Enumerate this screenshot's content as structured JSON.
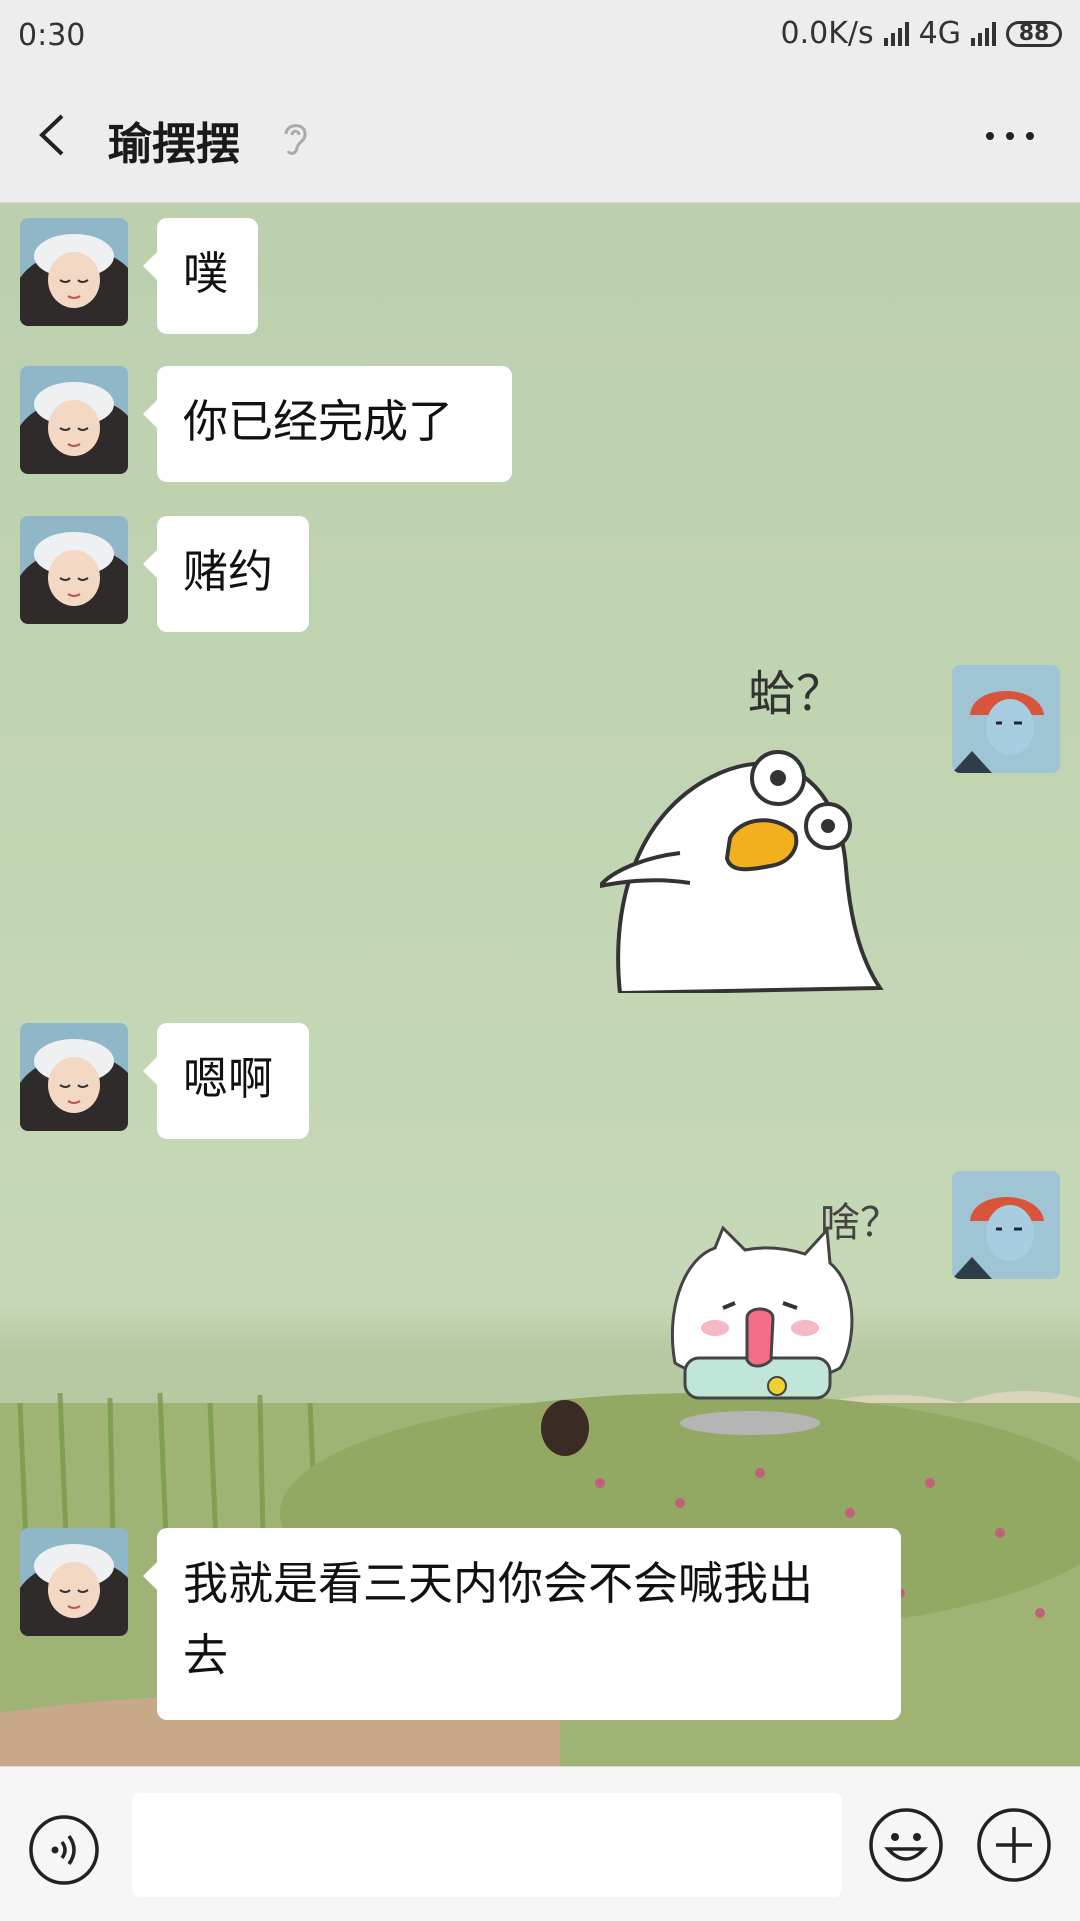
{
  "status": {
    "time": "0:30",
    "speed": "0.0K/s",
    "network": "4G",
    "battery": "88"
  },
  "header": {
    "title": "瑜摆摆"
  },
  "messages": [
    {
      "side": "left",
      "text": "噗"
    },
    {
      "side": "left",
      "text": "你已经完成了"
    },
    {
      "side": "left",
      "text": "赌约"
    },
    {
      "side": "right",
      "sticker": "duck-sticker",
      "sticker_text": "蛤？"
    },
    {
      "side": "left",
      "text": "嗯啊"
    },
    {
      "side": "right",
      "sticker": "cat-sticker",
      "sticker_text": "啥？"
    },
    {
      "side": "left",
      "text_line1": "我就是看三天内你会不会喊我出",
      "text_line2": "去"
    }
  ],
  "colors": {
    "bubble": "#ffffff",
    "chat_bg": "#c6d8b6",
    "bar": "#ededed",
    "beak": "#f2b01e"
  }
}
